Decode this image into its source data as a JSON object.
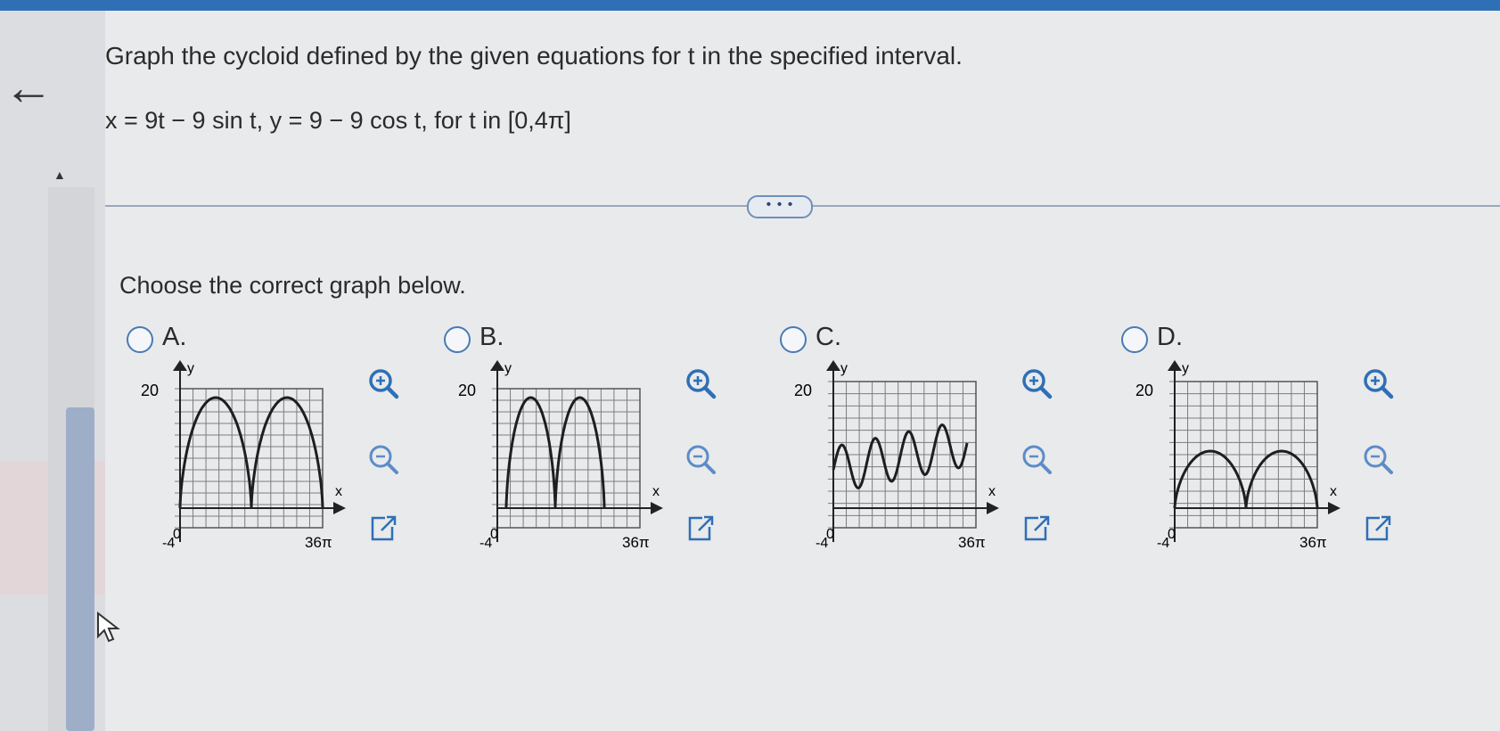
{
  "nav": {
    "back_icon_glyph": "←",
    "collapse_glyph": "▲"
  },
  "question": {
    "title": "Graph the cycloid defined by the given equations for t in the specified interval.",
    "equation": "x = 9t − 9 sin t, y = 9 − 9 cos t, for t in [0,4π]",
    "more_label": "• • •",
    "prompt": "Choose the correct graph below."
  },
  "options": [
    {
      "label": "A.",
      "y_tick": "20",
      "x_tick_min": "-4",
      "y_tick_zero": "0",
      "x_tick_max": "36π",
      "x_axis": "x",
      "y_axis": "y"
    },
    {
      "label": "B.",
      "y_tick": "20",
      "x_tick_min": "-4",
      "y_tick_zero": "0",
      "x_tick_max": "36π",
      "x_axis": "x",
      "y_axis": "y"
    },
    {
      "label": "C.",
      "y_tick": "20",
      "x_tick_min": "-4",
      "y_tick_zero": "0",
      "x_tick_max": "36π",
      "x_axis": "x",
      "y_axis": "y"
    },
    {
      "label": "D.",
      "y_tick": "20",
      "x_tick_min": "-4",
      "y_tick_zero": "0",
      "x_tick_max": "36π",
      "x_axis": "x",
      "y_axis": "y"
    }
  ],
  "tools": {
    "zoom_in": "zoom-in-icon",
    "zoom_out": "zoom-out-icon",
    "expand": "external-link-icon"
  },
  "colors": {
    "accent": "#2f6fb6",
    "grid": "#7d7d7d",
    "curve": "#1e1e1e"
  }
}
